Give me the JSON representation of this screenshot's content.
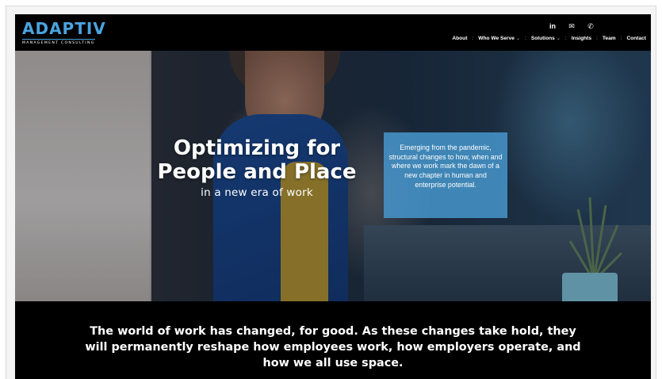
{
  "brand": {
    "name": "ADAPTIV",
    "tagline": "MANAGEMENT CONSULTING",
    "color": "#4aa3df"
  },
  "social": [
    {
      "label": "in",
      "icon": "linkedin-icon"
    },
    {
      "label": "✉",
      "icon": "email-icon"
    },
    {
      "label": "✆",
      "icon": "whatsapp-icon"
    }
  ],
  "nav": {
    "items": [
      {
        "label": "About",
        "dropdown": false
      },
      {
        "label": "Who We Serve",
        "dropdown": true
      },
      {
        "label": "Solutions",
        "dropdown": true
      },
      {
        "label": "Insights",
        "dropdown": false
      },
      {
        "label": "Team",
        "dropdown": false
      },
      {
        "label": "Contact",
        "dropdown": false
      }
    ],
    "separator": ":",
    "chevron": "⌄"
  },
  "hero": {
    "title_line1": "Optimizing for",
    "title_line2": "People and Place",
    "subtitle": "in a new era of work",
    "callout": "Emerging from the pandemic, structural changes to how, when and where we work mark the dawn of a new chapter in human and enterprise potential.",
    "callout_color": "#4696cd"
  },
  "intro": {
    "text": "The world of work has changed, for good. As these changes take hold, they will permanently reshape how employees work, how employers operate, and how we all use space."
  }
}
